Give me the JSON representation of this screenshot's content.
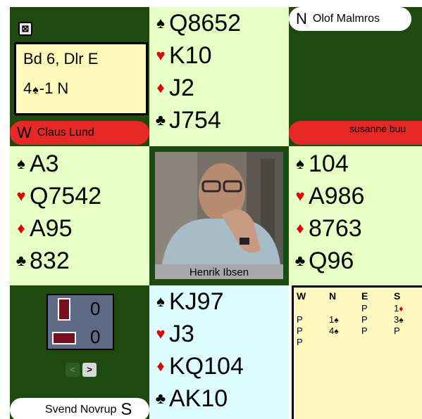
{
  "board": {
    "line1": "Bd 6, Dlr E",
    "contract_prefix": "4",
    "contract_suit": "♠",
    "contract_suffix": "-1 N"
  },
  "close_glyph": "⊠",
  "north": {
    "dir": "N",
    "name": "Olof Malmros",
    "hand": {
      "spades": "Q8652",
      "hearts": "K10",
      "diamonds": "J2",
      "clubs": "J754"
    }
  },
  "west": {
    "dir": "W",
    "name": "Claus Lund",
    "hand": {
      "spades": "A3",
      "hearts": "Q7542",
      "diamonds": "A95",
      "clubs": "832"
    }
  },
  "east": {
    "dir": "",
    "name": "susanne buu",
    "hand": {
      "spades": "104",
      "hearts": "A986",
      "diamonds": "8763",
      "clubs": "Q96"
    }
  },
  "south": {
    "dir": "S",
    "name": "Svend Novrup",
    "hand": {
      "spades": "KJ97",
      "hearts": "J3",
      "diamonds": "KQ104",
      "clubs": "AK10"
    }
  },
  "suits": {
    "spades": "♠",
    "hearts": "♥",
    "diamonds": "♦",
    "clubs": "♣"
  },
  "video": {
    "caption": "Henrik Ibsen"
  },
  "tricks": {
    "ns": "0",
    "ew": "0"
  },
  "nav": {
    "prev": "<",
    "next": ">"
  },
  "bidding": {
    "headers": [
      "W",
      "N",
      "E",
      "S"
    ],
    "rows": [
      [
        "",
        "",
        "P",
        "1♦"
      ],
      [
        "P",
        "1♠",
        "P",
        "3♠"
      ],
      [
        "P",
        "4♠",
        "P",
        "P"
      ],
      [
        "P",
        "",
        "",
        ""
      ]
    ]
  },
  "colors": {
    "table_green": "#1f4a0f",
    "hand_green": "#e6ffc4",
    "hand_blue": "#dcfcff",
    "pill_red": "#e82727",
    "suit_red": "#e00000"
  }
}
